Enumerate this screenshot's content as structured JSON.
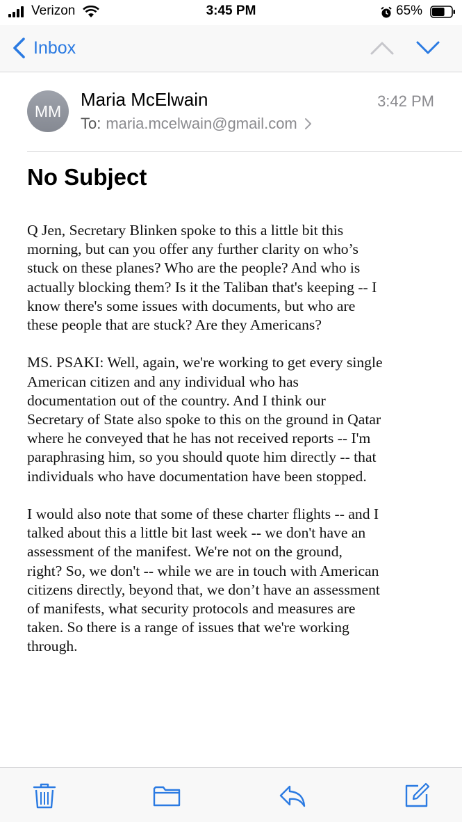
{
  "status_bar": {
    "carrier": "Verizon",
    "time": "3:45 PM",
    "battery": "65%",
    "battery_level": 0.65,
    "icons": [
      "cellular-signal-icon",
      "wifi-icon",
      "alarm-icon",
      "battery-icon"
    ]
  },
  "nav": {
    "back_label": "Inbox",
    "icons": [
      "chevron-left-icon",
      "chevron-up-icon",
      "chevron-down-icon"
    ],
    "accent_color": "#2a7ae2"
  },
  "header": {
    "avatar_initials": "MM",
    "sender": "Maria McElwain",
    "to_label": "To:",
    "recipient": "maria.mcelwain@gmail.com",
    "time": "3:42 PM"
  },
  "subject": "No Subject",
  "body": {
    "paragraphs": [
      "Q   Jen, Secretary Blinken spoke to this a little bit this\nmorning, but can you offer any further clarity on who’s\nstuck on these planes?  Who are the people?  And who is\nactually blocking them?  Is it the Taliban that's keeping -- I\nknow there's some issues with documents, but who are\nthese people that are stuck?  Are they Americans?",
      "MS. PSAKI:  Well, again, we're working to get every single\nAmerican citizen and any individual who has\ndocumentation out of the country.  And I think our\nSecretary of State also spoke to this on the ground in Qatar\nwhere he conveyed that he has not received reports -- I'm\nparaphrasing him, so you should quote him directly -- that\nindividuals who have documentation have been stopped.",
      "I would also note that some of these charter flights -- and I\ntalked about this a little bit last week -- we don't have an\nassessment of the manifest.  We're not on the ground,\nright?  So, we don't -- while we are in touch with American\ncitizens directly, beyond that, we don’t have an assessment\nof manifests, what security protocols and measures are\ntaken.  So there is a range of issues that we're working\nthrough."
    ]
  },
  "toolbar": {
    "icons": [
      "trash-icon",
      "folder-icon",
      "reply-icon",
      "compose-icon"
    ]
  }
}
